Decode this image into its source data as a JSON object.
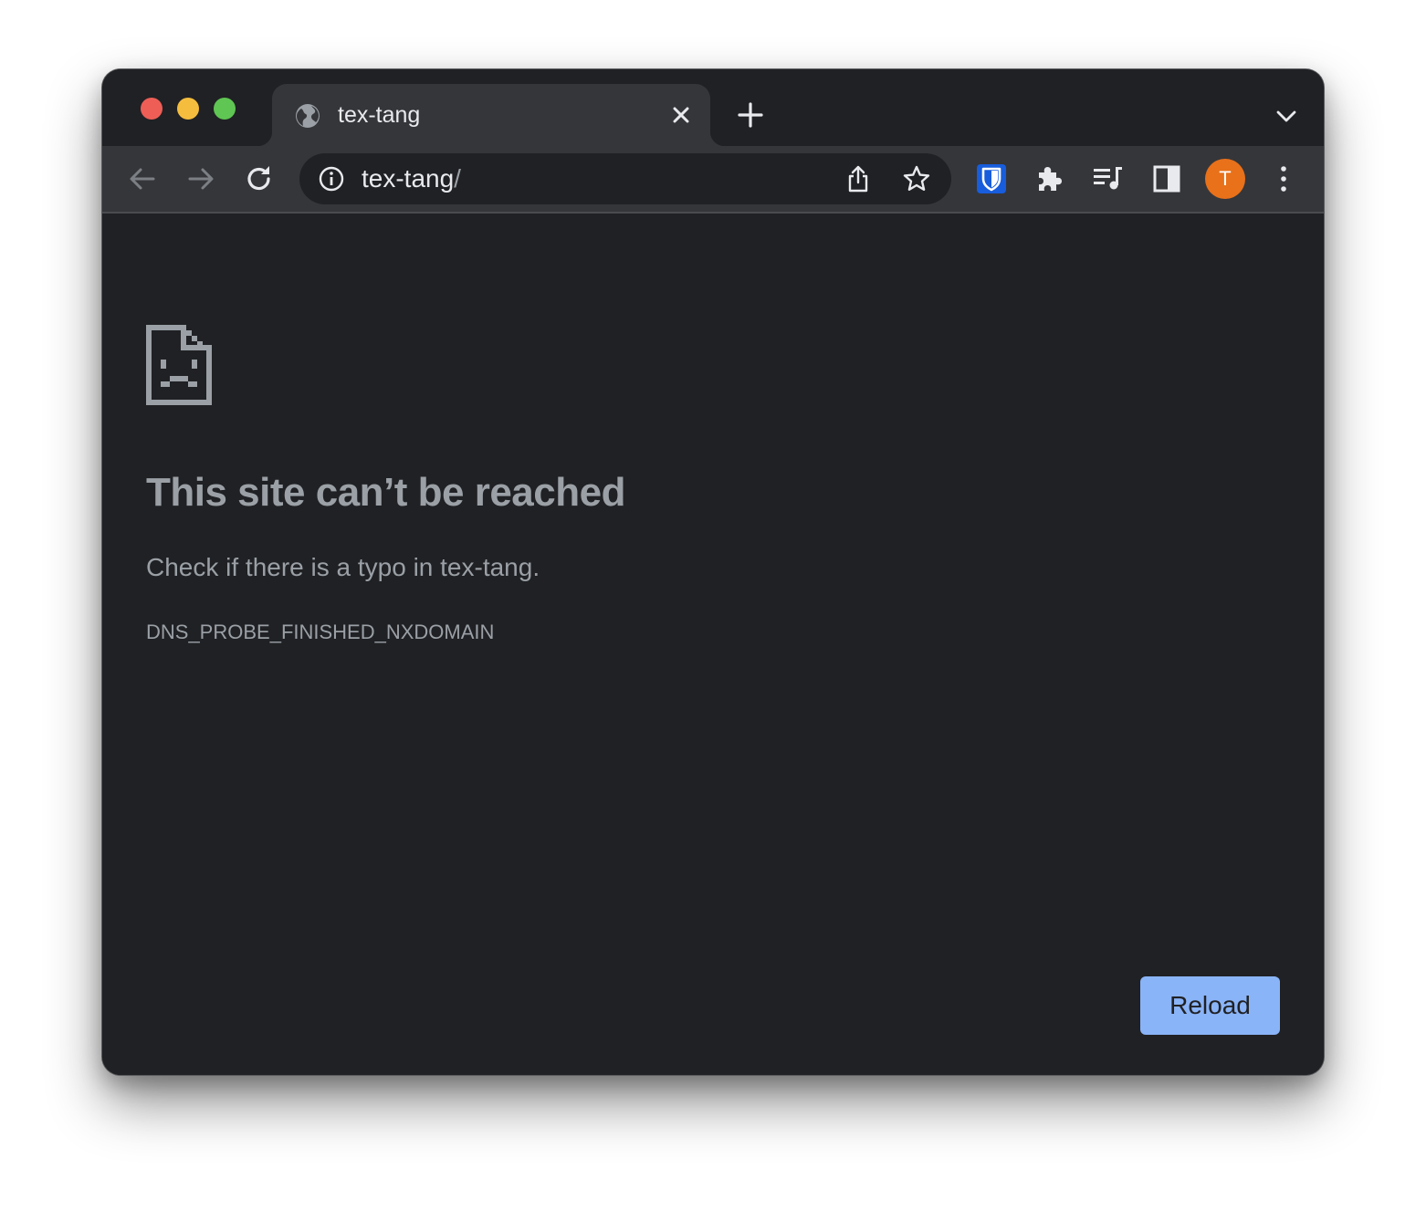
{
  "tab": {
    "title": "tex-tang",
    "favicon": "globe-icon",
    "close_icon": "close-icon"
  },
  "tabstrip": {
    "new_tab_icon": "plus-icon",
    "tab_search_icon": "chevron-down-icon"
  },
  "toolbar": {
    "back_icon": "arrow-left-icon",
    "forward_icon": "arrow-right-icon",
    "reload_icon": "reload-icon",
    "omnibox": {
      "info_icon": "info-icon",
      "host": "tex-tang",
      "path": "/",
      "share_icon": "share-icon",
      "bookmark_icon": "star-icon"
    },
    "extensions": [
      {
        "name": "bitwarden-icon",
        "color": "#175ddc"
      },
      {
        "name": "puzzle-icon"
      },
      {
        "name": "media-queue-icon"
      },
      {
        "name": "side-panel-icon"
      }
    ],
    "profile_initial": "T",
    "profile_color": "#e8711a",
    "menu_icon": "kebab-menu-icon"
  },
  "error_page": {
    "icon": "sad-document-icon",
    "headline": "This site can’t be reached",
    "suggestion": "Check if there is a typo in tex-tang.",
    "error_code": "DNS_PROBE_FINISHED_NXDOMAIN",
    "reload_label": "Reload",
    "reload_color": "#8ab4f8"
  },
  "window_controls": {
    "close_color": "#ee5e56",
    "minimize_color": "#f5bd3e",
    "zoom_color": "#5fc553"
  }
}
